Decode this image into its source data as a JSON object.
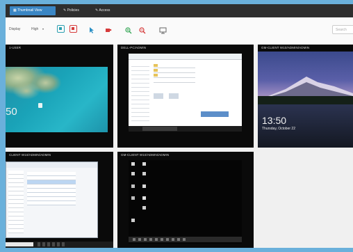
{
  "tabs": [
    {
      "label": "Thumbnail View",
      "icon": "grid-icon",
      "active": true
    },
    {
      "label": "Policies",
      "icon": "wrench-icon",
      "active": false
    },
    {
      "label": "Access",
      "icon": "wrench-icon",
      "active": false
    }
  ],
  "toolbar": {
    "display_label": "Display",
    "size_value": "High",
    "search_placeholder": "Search"
  },
  "tiles": [
    {
      "title": "1-USER",
      "clock": "50"
    },
    {
      "title": "DELL-PC/ADMIN"
    },
    {
      "title": "GM-CLIENT W10/ADMIN/ADMIN",
      "clock": "13:50",
      "date": "Thursday, October 22"
    },
    {
      "title": "CLIENT W10/ADMIN/ADMIN"
    },
    {
      "title": "GM-CLIENT W10/ADMIN/ADMIN"
    }
  ]
}
